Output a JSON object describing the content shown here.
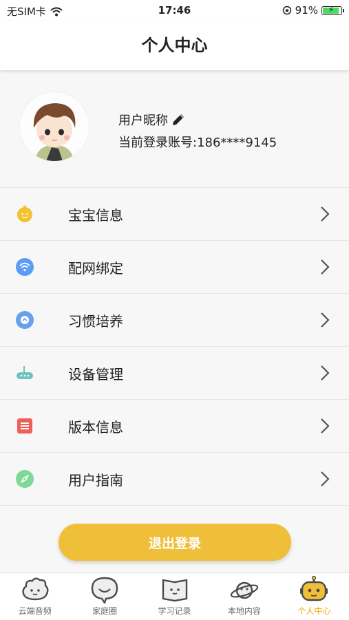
{
  "status_bar": {
    "carrier": "无SIM卡",
    "time": "17:46",
    "battery": "91%",
    "battery_level": 0.91
  },
  "header": {
    "title": "个人中心"
  },
  "profile": {
    "nickname": "用户昵称",
    "account": "当前登录账号:186****9145"
  },
  "menu": [
    {
      "label": "宝宝信息",
      "icon": "baby-icon",
      "color": "#f2c232"
    },
    {
      "label": "配网绑定",
      "icon": "wifi-icon",
      "color": "#5b9df5"
    },
    {
      "label": "习惯培养",
      "icon": "habit-icon",
      "color": "#6a9ff0"
    },
    {
      "label": "设备管理",
      "icon": "router-icon",
      "color": "#6bc4c0"
    },
    {
      "label": "版本信息",
      "icon": "document-icon",
      "color": "#ef5f5a"
    },
    {
      "label": "用户指南",
      "icon": "compass-icon",
      "color": "#7ed896"
    }
  ],
  "logout_label": "退出登录",
  "tabs": [
    {
      "label": "云端音频",
      "icon": "cloud-icon"
    },
    {
      "label": "家庭圈",
      "icon": "chat-bubble-icon"
    },
    {
      "label": "学习记录",
      "icon": "book-icon"
    },
    {
      "label": "本地内容",
      "icon": "planet-icon"
    },
    {
      "label": "个人中心",
      "icon": "robot-icon",
      "active": true
    }
  ],
  "colors": {
    "accent": "#f0bf3a",
    "tab_active": "#f0a600"
  }
}
